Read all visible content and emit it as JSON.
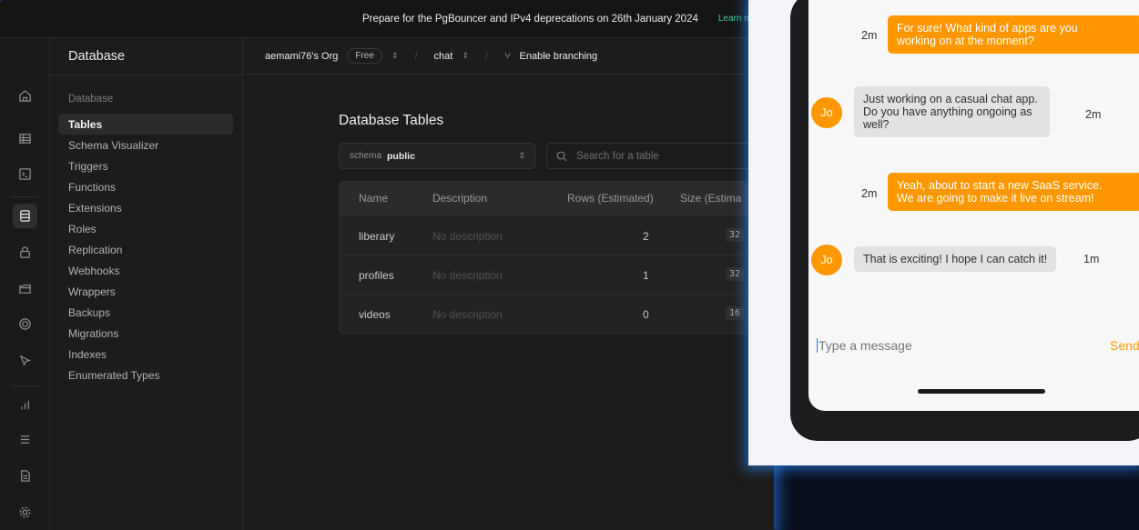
{
  "banner": {
    "message": "Prepare for the PgBouncer and IPv4 deprecations on 26th January 2024",
    "learn_more": "Learn more"
  },
  "sidebar": {
    "title": "Database",
    "group_label": "Database",
    "items": [
      {
        "label": "Tables",
        "active": true
      },
      {
        "label": "Schema Visualizer"
      },
      {
        "label": "Triggers"
      },
      {
        "label": "Functions"
      },
      {
        "label": "Extensions"
      },
      {
        "label": "Roles"
      },
      {
        "label": "Replication"
      },
      {
        "label": "Webhooks"
      },
      {
        "label": "Wrappers"
      },
      {
        "label": "Backups"
      },
      {
        "label": "Migrations"
      },
      {
        "label": "Indexes"
      },
      {
        "label": "Enumerated Types"
      }
    ]
  },
  "topbar": {
    "org": "aemami76's Org",
    "plan": "Free",
    "project": "chat",
    "branching": "Enable branching"
  },
  "main": {
    "heading": "Database Tables",
    "schema_label": "schema",
    "schema_value": "public",
    "search_placeholder": "Search for a table",
    "columns": [
      "Name",
      "Description",
      "Rows (Estimated)",
      "Size (Estima"
    ],
    "rows": [
      {
        "name": "liberary",
        "description": "No description",
        "rows": "2",
        "size": "32"
      },
      {
        "name": "profiles",
        "description": "No description",
        "rows": "1",
        "size": "32"
      },
      {
        "name": "videos",
        "description": "No description",
        "rows": "0",
        "size": "16"
      }
    ]
  },
  "chat": {
    "messages": [
      {
        "from": "me",
        "time": "2m",
        "text1": "For sure! What kind of apps are you",
        "text2": "working on at the moment?"
      },
      {
        "from": "them",
        "initials": "Jo",
        "time": "2m",
        "text1": "Just working on a casual chat app.",
        "text2": "Do you have anything ongoing as",
        "text3": "well?"
      },
      {
        "from": "me",
        "time": "2m",
        "text1": "Yeah, about to start a new SaaS service.",
        "text2": "We are going to make it live on stream!"
      },
      {
        "from": "them",
        "initials": "Jo",
        "time": "1m",
        "text1": "That is exciting! I hope I can catch it!"
      }
    ],
    "input_placeholder": "Type a message",
    "send_label": "Send"
  },
  "colors": {
    "supabase_green": "#3ecf8e",
    "chat_accent": "#ff9800",
    "dark_bg": "#1c1c1c"
  }
}
